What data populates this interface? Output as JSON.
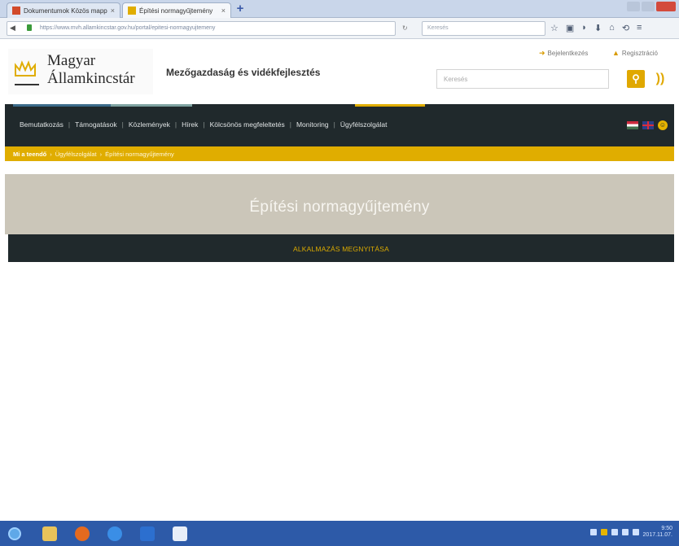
{
  "browser": {
    "tabs": [
      {
        "title": "Dokumentumok Közös mapp",
        "active": false
      },
      {
        "title": "Építési normagyűjtemény",
        "active": true
      }
    ],
    "url": "https://www.mvh.allamkincstar.gov.hu/portal/epitesi-normagyujtemeny",
    "search_placeholder": "Keresés"
  },
  "header": {
    "logo_line1": "Magyar",
    "logo_line2": "Államkincstár",
    "tagline": "Mezőgazdaság és vidékfejlesztés",
    "login_label": "Bejelentkezés",
    "register_label": "Regisztráció",
    "search_placeholder": "Keresés"
  },
  "nav": {
    "items": [
      "Bemutatkozás",
      "Támogatások",
      "Közlemények",
      "Hírek",
      "Kölcsönös megfeleltetés",
      "Monitoring",
      "Ügyfélszolgálat"
    ]
  },
  "breadcrumb": [
    "Mi a teendő",
    "Ügyfélszolgálat",
    "Építési normagyűjtemény"
  ],
  "hero": {
    "title": "Építési normagyűjtemény",
    "open_link": "ALKALMAZÁS MEGNYITÁSA"
  },
  "taskbar": {
    "clock_time": "9:50",
    "clock_date": "2017.11.07."
  },
  "colors": {
    "nav_bg": "#20292c",
    "accent_gold": "#e0ad00",
    "hero_bg": "#cbc6b9"
  }
}
